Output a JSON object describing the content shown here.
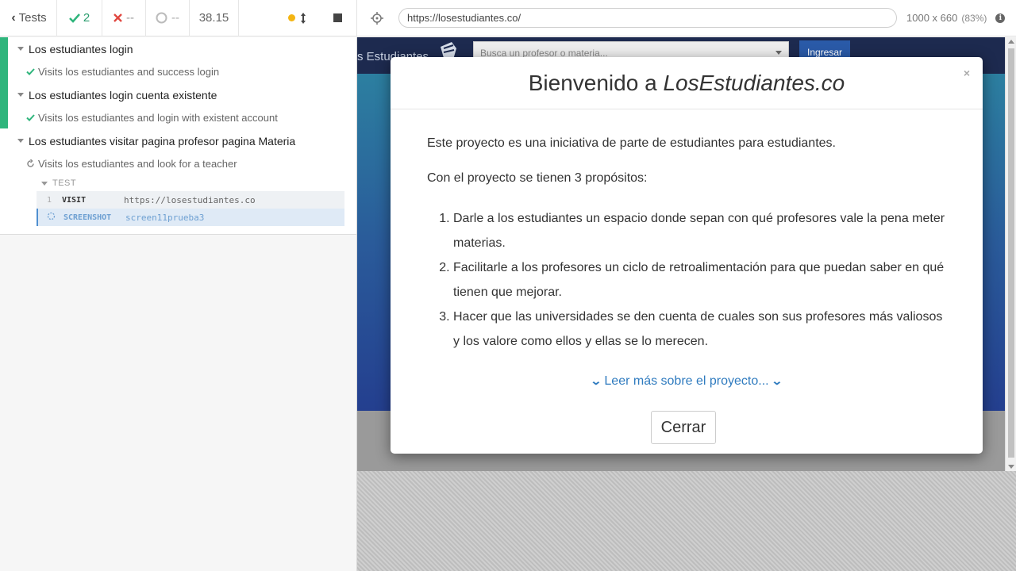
{
  "header": {
    "tests_label": "Tests",
    "passed_count": "2",
    "failed_count": "--",
    "pending_count": "--",
    "duration": "38.15"
  },
  "url_bar": {
    "url": "https://losestudiantes.co/",
    "viewport": "1000 x 660",
    "zoom": "(83%)"
  },
  "reporter": {
    "suites": [
      {
        "title": "Los estudiantes login",
        "tests": [
          {
            "title": "Visits los estudiantes and success login",
            "state": "passed"
          }
        ]
      },
      {
        "title": "Los estudiantes login cuenta existente",
        "tests": [
          {
            "title": "Visits los estudiantes and login with existent account",
            "state": "passed"
          }
        ]
      },
      {
        "title": "Los estudiantes visitar pagina profesor pagina Materia",
        "tests": [
          {
            "title": "Visits los estudiantes and look for a teacher",
            "state": "running"
          }
        ]
      }
    ],
    "command_section": "TEST",
    "commands": [
      {
        "num": "1",
        "name": "VISIT",
        "message": "https://losestudiantes.co"
      },
      {
        "num": "",
        "name": "SCREENSHOT",
        "message": "screen11prueba3"
      }
    ]
  },
  "app": {
    "logo_text": "s Estudiantes",
    "search_placeholder": "Busca un profesor o materia...",
    "login_button": "Ingresar"
  },
  "modal": {
    "title_prefix": "Bienvenido a ",
    "title_brand": "LosEstudiantes.co",
    "close_x": "×",
    "intro": "Este proyecto es una iniciativa de parte de estudiantes para estudiantes.",
    "purposes_intro": "Con el proyecto se tienen 3 propósitos:",
    "purposes": [
      "Darle a los estudiantes un espacio donde sepan con qué profesores vale la pena meter materias.",
      "Facilitarle a los profesores un ciclo de retroalimentación para que puedan saber en qué tienen que mejorar.",
      "Hacer que las universidades se den cuenta de cuales son sus profesores más valiosos y los valore como ellos y ellas se lo merecen."
    ],
    "read_more": "Leer más sobre el proyecto...",
    "close_button": "Cerrar"
  },
  "colors": {
    "pass": "#2fb57c",
    "link": "#2f7bbf",
    "running": "#f4b512"
  }
}
